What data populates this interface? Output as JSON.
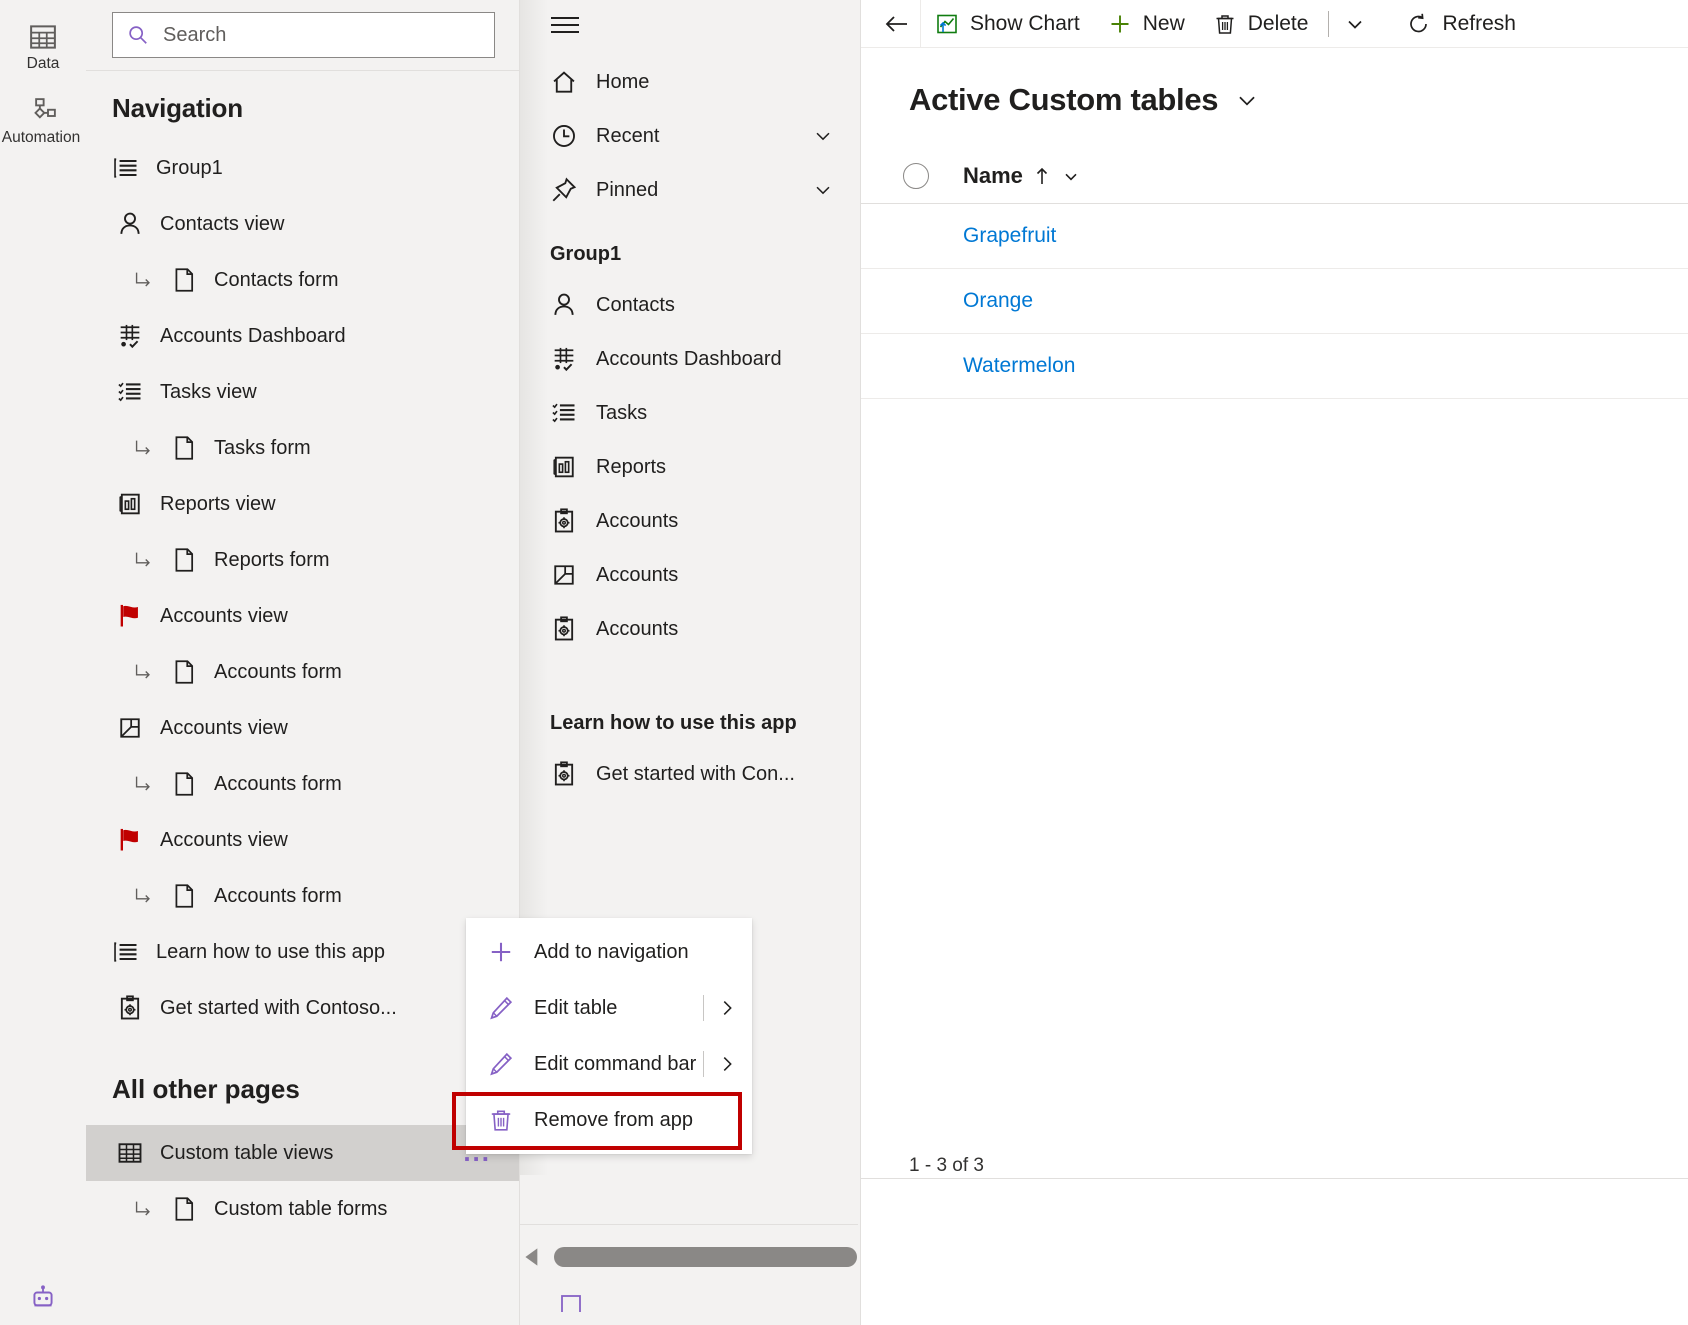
{
  "rail": {
    "items": [
      {
        "label": "Data",
        "icon": "table-icon"
      },
      {
        "label": "Automation",
        "icon": "automation-icon"
      }
    ],
    "bottom_icon": "copilot-robot-icon"
  },
  "search": {
    "placeholder": "Search",
    "icon": "search-icon"
  },
  "navigation": {
    "title": "Navigation",
    "tree": [
      {
        "label": "Group1",
        "icon": "group-list-icon",
        "indent": 0
      },
      {
        "label": "Contacts view",
        "icon": "contact-person-icon",
        "indent": 1
      },
      {
        "label": "Contacts form",
        "icon": "form-page-icon",
        "indent": 2,
        "elbow": true
      },
      {
        "label": "Accounts Dashboard",
        "icon": "dashboard-icon",
        "indent": 1
      },
      {
        "label": "Tasks view",
        "icon": "task-list-icon",
        "indent": 1
      },
      {
        "label": "Tasks form",
        "icon": "form-page-icon",
        "indent": 2,
        "elbow": true
      },
      {
        "label": "Reports view",
        "icon": "report-chart-icon",
        "indent": 1
      },
      {
        "label": "Reports form",
        "icon": "form-page-icon",
        "indent": 2,
        "elbow": true
      },
      {
        "label": "Accounts view",
        "icon": "red-flag-icon",
        "indent": 1
      },
      {
        "label": "Accounts form",
        "icon": "form-page-icon",
        "indent": 2,
        "elbow": true
      },
      {
        "label": "Accounts view",
        "icon": "folder-view-icon",
        "indent": 1
      },
      {
        "label": "Accounts form",
        "icon": "form-page-icon",
        "indent": 2,
        "elbow": true
      },
      {
        "label": "Accounts view",
        "icon": "red-flag-icon",
        "indent": 1
      },
      {
        "label": "Accounts form",
        "icon": "form-page-icon",
        "indent": 2,
        "elbow": true
      },
      {
        "label": "Learn how to use this app",
        "icon": "group-list-icon",
        "indent": 0
      },
      {
        "label": "Get started with Contoso...",
        "icon": "clipboard-gear-icon",
        "indent": 1
      }
    ],
    "other_pages_heading": "All other pages",
    "other_pages": [
      {
        "label": "Custom table views",
        "icon": "table-grid-icon",
        "indent": 1,
        "selected": true,
        "overflow": "..."
      },
      {
        "label": "Custom table forms",
        "icon": "form-page-icon",
        "indent": 2,
        "elbow": true
      }
    ]
  },
  "preview": {
    "hamburger_icon": "hamburger-icon",
    "top_items": [
      {
        "label": "Home",
        "icon": "home-icon",
        "chevron": false
      },
      {
        "label": "Recent",
        "icon": "clock-icon",
        "chevron": true
      },
      {
        "label": "Pinned",
        "icon": "pin-icon",
        "chevron": true
      }
    ],
    "group_label": "Group1",
    "group_items": [
      {
        "label": "Contacts",
        "icon": "contact-person-icon"
      },
      {
        "label": "Accounts Dashboard",
        "icon": "dashboard-icon"
      },
      {
        "label": "Tasks",
        "icon": "task-list-icon"
      },
      {
        "label": "Reports",
        "icon": "report-chart-icon"
      },
      {
        "label": "Accounts",
        "icon": "clipboard-gear-icon"
      },
      {
        "label": "Accounts",
        "icon": "folder-view-icon"
      },
      {
        "label": "Accounts",
        "icon": "clipboard-gear-icon"
      }
    ],
    "learn_label": "Learn how to use this app",
    "learn_items": [
      {
        "label": "Get started with Con...",
        "icon": "clipboard-gear-icon"
      }
    ]
  },
  "commandbar": {
    "back_icon": "back-arrow-icon",
    "buttons": [
      {
        "label": "Show Chart",
        "icon": "show-chart-icon"
      },
      {
        "label": "New",
        "icon": "plus-icon"
      },
      {
        "label": "Delete",
        "icon": "trash-icon"
      }
    ],
    "overflow_icon": "chevron-down-icon",
    "refresh": {
      "label": "Refresh",
      "icon": "refresh-icon"
    }
  },
  "view": {
    "title": "Active Custom tables",
    "title_chevron_icon": "chevron-down-icon",
    "columns": [
      {
        "label": "Name",
        "sort_icon": "sort-asc-arrow-icon",
        "menu_icon": "chevron-down-icon"
      }
    ],
    "rows": [
      {
        "name": "Grapefruit"
      },
      {
        "name": "Orange"
      },
      {
        "name": "Watermelon"
      }
    ],
    "pager": "1 - 3 of 3"
  },
  "contextmenu": {
    "items": [
      {
        "label": "Add to navigation",
        "icon": "plus-icon",
        "submenu": false,
        "highlighted": false
      },
      {
        "label": "Edit table",
        "icon": "pencil-icon",
        "submenu": true,
        "highlighted": false
      },
      {
        "label": "Edit command bar",
        "icon": "pencil-icon",
        "submenu": true,
        "highlighted": false
      },
      {
        "label": "Remove from app",
        "icon": "trash-icon",
        "submenu": false,
        "highlighted": true
      }
    ]
  },
  "scrollbar": {
    "left_arrow_icon": "scroll-left-arrow-icon"
  },
  "colors": {
    "accent_purple": "#8661c5",
    "link_blue": "#0078d4",
    "flag_red": "#c00000",
    "highlight_red": "#c00000",
    "new_green": "#498205",
    "panel_bg": "#f3f2f1",
    "selected_row": "#d2d0ce"
  }
}
